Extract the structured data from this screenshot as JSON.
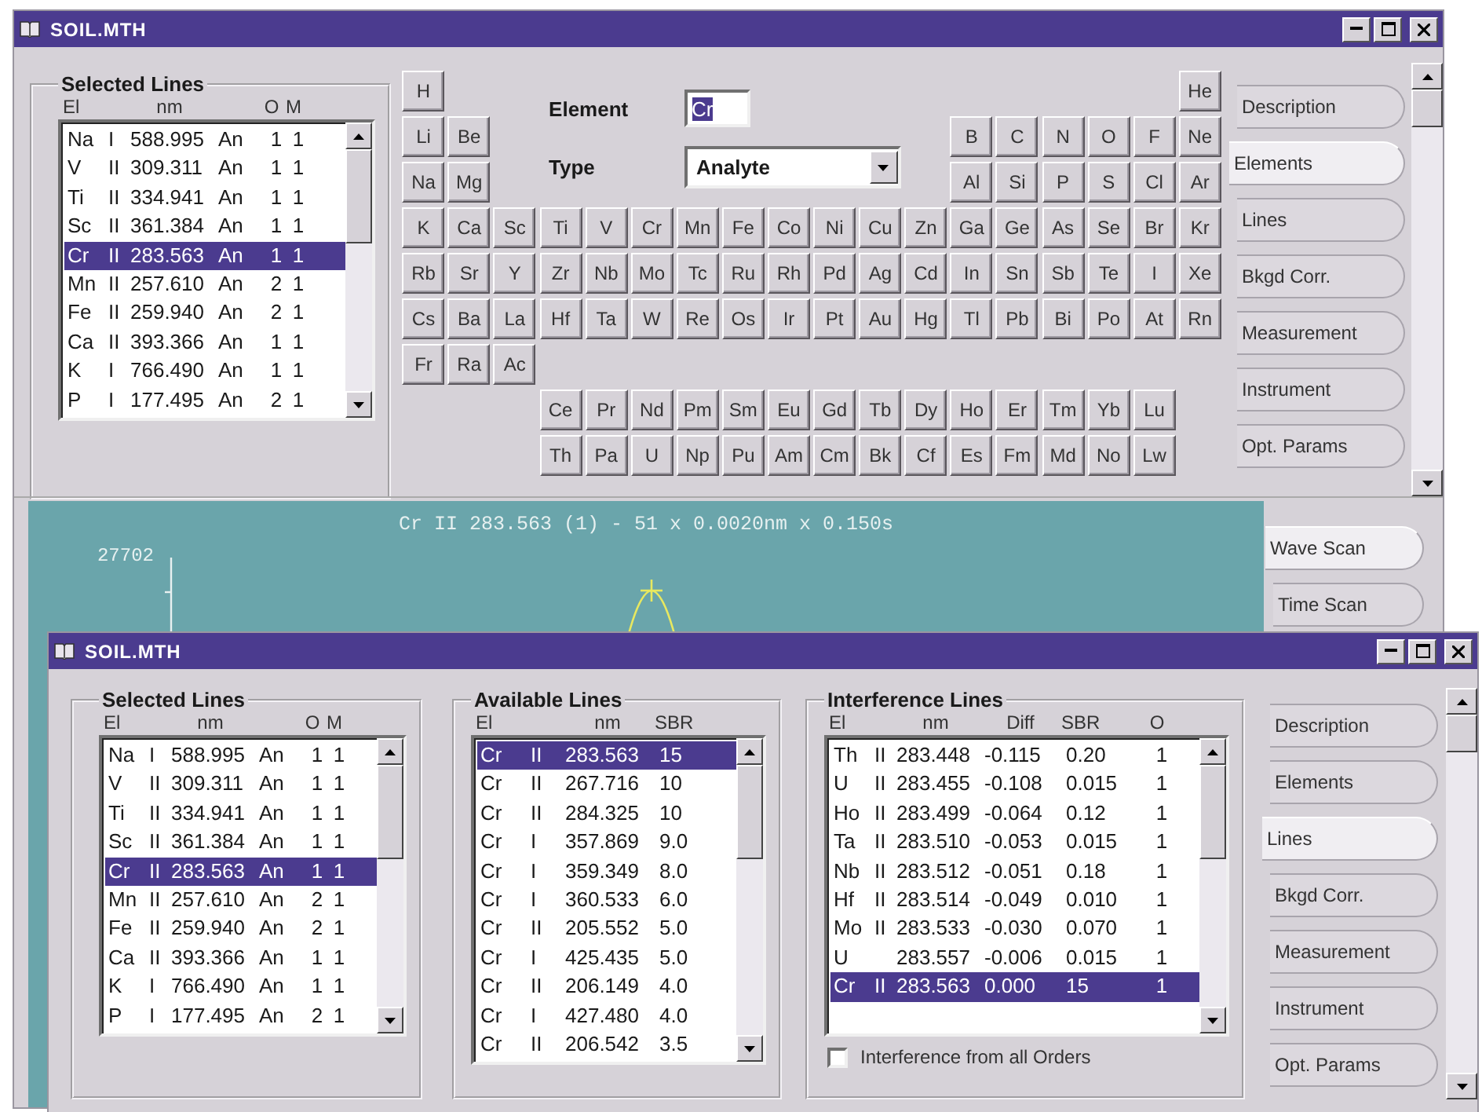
{
  "main_window": {
    "title": "SOIL.MTH",
    "selected_lines": {
      "title": "Selected Lines",
      "kind": "selected",
      "headers": {
        "el": "El",
        "nm": "nm",
        "o": "O",
        "m": "M"
      },
      "rows": [
        {
          "el": "Na",
          "ion": "I",
          "nm": "588.995",
          "type": "An",
          "o": "1",
          "m": "1",
          "selected": false
        },
        {
          "el": "V",
          "ion": "II",
          "nm": "309.311",
          "type": "An",
          "o": "1",
          "m": "1",
          "selected": false
        },
        {
          "el": "Ti",
          "ion": "II",
          "nm": "334.941",
          "type": "An",
          "o": "1",
          "m": "1",
          "selected": false
        },
        {
          "el": "Sc",
          "ion": "II",
          "nm": "361.384",
          "type": "An",
          "o": "1",
          "m": "1",
          "selected": false
        },
        {
          "el": "Cr",
          "ion": "II",
          "nm": "283.563",
          "type": "An",
          "o": "1",
          "m": "1",
          "selected": true
        },
        {
          "el": "Mn",
          "ion": "II",
          "nm": "257.610",
          "type": "An",
          "o": "2",
          "m": "1",
          "selected": false
        },
        {
          "el": "Fe",
          "ion": "II",
          "nm": "259.940",
          "type": "An",
          "o": "2",
          "m": "1",
          "selected": false
        },
        {
          "el": "Ca",
          "ion": "II",
          "nm": "393.366",
          "type": "An",
          "o": "1",
          "m": "1",
          "selected": false
        },
        {
          "el": "K",
          "ion": "I",
          "nm": "766.490",
          "type": "An",
          "o": "1",
          "m": "1",
          "selected": false
        },
        {
          "el": "P",
          "ion": "I",
          "nm": "177.495",
          "type": "An",
          "o": "2",
          "m": "1",
          "selected": false
        }
      ]
    },
    "element_field": {
      "label": "Element",
      "value": "Cr"
    },
    "type_field": {
      "label": "Type",
      "value": "Analyte"
    },
    "periodic_table": [
      [
        "H",
        "He"
      ],
      [
        "Li",
        "Be",
        "B",
        "C",
        "N",
        "O",
        "F",
        "Ne"
      ],
      [
        "Na",
        "Mg",
        "Al",
        "Si",
        "P",
        "S",
        "Cl",
        "Ar"
      ],
      [
        "K",
        "Ca",
        "Sc",
        "Ti",
        "V",
        "Cr",
        "Mn",
        "Fe",
        "Co",
        "Ni",
        "Cu",
        "Zn",
        "Ga",
        "Ge",
        "As",
        "Se",
        "Br",
        "Kr"
      ],
      [
        "Rb",
        "Sr",
        "Y",
        "Zr",
        "Nb",
        "Mo",
        "Tc",
        "Ru",
        "Rh",
        "Pd",
        "Ag",
        "Cd",
        "In",
        "Sn",
        "Sb",
        "Te",
        "I",
        "Xe"
      ],
      [
        "Cs",
        "Ba",
        "La",
        "Hf",
        "Ta",
        "W",
        "Re",
        "Os",
        "Ir",
        "Pt",
        "Au",
        "Hg",
        "Tl",
        "Pb",
        "Bi",
        "Po",
        "At",
        "Rn"
      ],
      [
        "Fr",
        "Ra",
        "Ac"
      ],
      [
        "Ce",
        "Pr",
        "Nd",
        "Pm",
        "Sm",
        "Eu",
        "Gd",
        "Tb",
        "Dy",
        "Ho",
        "Er",
        "Tm",
        "Yb",
        "Lu"
      ],
      [
        "Th",
        "Pa",
        "U",
        "Np",
        "Pu",
        "Am",
        "Cm",
        "Bk",
        "Cf",
        "Es",
        "Fm",
        "Md",
        "No",
        "Lw"
      ]
    ],
    "tabs": [
      {
        "label": "Description",
        "selected": false
      },
      {
        "label": "Elements",
        "selected": true
      },
      {
        "label": "Lines",
        "selected": false
      },
      {
        "label": "Bkgd Corr.",
        "selected": false
      },
      {
        "label": "Measurement",
        "selected": false
      },
      {
        "label": "Instrument",
        "selected": false
      },
      {
        "label": "Opt. Params",
        "selected": false
      }
    ],
    "chart_title": "Cr II 283.563 (1) - 51 x 0.0020nm x 0.150s",
    "y_axis_max": "27702",
    "scan_tabs": [
      {
        "label": "Wave Scan",
        "selected": true
      },
      {
        "label": "Time Scan",
        "selected": false
      }
    ]
  },
  "lines_window": {
    "title": "SOIL.MTH",
    "selected_lines": {
      "title": "Selected Lines",
      "kind": "selected",
      "headers": {
        "el": "El",
        "nm": "nm",
        "o": "O",
        "m": "M"
      },
      "rows": [
        {
          "el": "Na",
          "ion": "I",
          "nm": "588.995",
          "type": "An",
          "o": "1",
          "m": "1",
          "selected": false
        },
        {
          "el": "V",
          "ion": "II",
          "nm": "309.311",
          "type": "An",
          "o": "1",
          "m": "1",
          "selected": false
        },
        {
          "el": "Ti",
          "ion": "II",
          "nm": "334.941",
          "type": "An",
          "o": "1",
          "m": "1",
          "selected": false
        },
        {
          "el": "Sc",
          "ion": "II",
          "nm": "361.384",
          "type": "An",
          "o": "1",
          "m": "1",
          "selected": false
        },
        {
          "el": "Cr",
          "ion": "II",
          "nm": "283.563",
          "type": "An",
          "o": "1",
          "m": "1",
          "selected": true
        },
        {
          "el": "Mn",
          "ion": "II",
          "nm": "257.610",
          "type": "An",
          "o": "2",
          "m": "1",
          "selected": false
        },
        {
          "el": "Fe",
          "ion": "II",
          "nm": "259.940",
          "type": "An",
          "o": "2",
          "m": "1",
          "selected": false
        },
        {
          "el": "Ca",
          "ion": "II",
          "nm": "393.366",
          "type": "An",
          "o": "1",
          "m": "1",
          "selected": false
        },
        {
          "el": "K",
          "ion": "I",
          "nm": "766.490",
          "type": "An",
          "o": "1",
          "m": "1",
          "selected": false
        },
        {
          "el": "P",
          "ion": "I",
          "nm": "177.495",
          "type": "An",
          "o": "2",
          "m": "1",
          "selected": false
        }
      ]
    },
    "available_lines": {
      "title": "Available Lines",
      "kind": "available",
      "headers": {
        "el": "El",
        "nm": "nm",
        "sbr": "SBR"
      },
      "rows": [
        {
          "el": "Cr",
          "ion": "II",
          "nm": "283.563",
          "sbr": "15",
          "selected": true
        },
        {
          "el": "Cr",
          "ion": "II",
          "nm": "267.716",
          "sbr": "10",
          "selected": false
        },
        {
          "el": "Cr",
          "ion": "II",
          "nm": "284.325",
          "sbr": "10",
          "selected": false
        },
        {
          "el": "Cr",
          "ion": "I",
          "nm": "357.869",
          "sbr": "9.0",
          "selected": false
        },
        {
          "el": "Cr",
          "ion": "I",
          "nm": "359.349",
          "sbr": "8.0",
          "selected": false
        },
        {
          "el": "Cr",
          "ion": "I",
          "nm": "360.533",
          "sbr": "6.0",
          "selected": false
        },
        {
          "el": "Cr",
          "ion": "II",
          "nm": "205.552",
          "sbr": "5.0",
          "selected": false
        },
        {
          "el": "Cr",
          "ion": "I",
          "nm": "425.435",
          "sbr": "5.0",
          "selected": false
        },
        {
          "el": "Cr",
          "ion": "II",
          "nm": "206.149",
          "sbr": "4.0",
          "selected": false
        },
        {
          "el": "Cr",
          "ion": "I",
          "nm": "427.480",
          "sbr": "4.0",
          "selected": false
        },
        {
          "el": "Cr",
          "ion": "II",
          "nm": "206.542",
          "sbr": "3.5",
          "selected": false
        }
      ]
    },
    "interference_lines": {
      "title": "Interference Lines",
      "kind": "interference",
      "headers": {
        "el": "El",
        "nm": "nm",
        "diff": "Diff",
        "sbr": "SBR",
        "o": "O"
      },
      "rows": [
        {
          "el": "Th",
          "ion": "II",
          "nm": "283.448",
          "diff": "-0.115",
          "sbr": "0.20",
          "o": "1",
          "selected": false
        },
        {
          "el": "U",
          "ion": "II",
          "nm": "283.455",
          "diff": "-0.108",
          "sbr": "0.015",
          "o": "1",
          "selected": false
        },
        {
          "el": "Ho",
          "ion": "II",
          "nm": "283.499",
          "diff": "-0.064",
          "sbr": "0.12",
          "o": "1",
          "selected": false
        },
        {
          "el": "Ta",
          "ion": "II",
          "nm": "283.510",
          "diff": "-0.053",
          "sbr": "0.015",
          "o": "1",
          "selected": false
        },
        {
          "el": "Nb",
          "ion": "II",
          "nm": "283.512",
          "diff": "-0.051",
          "sbr": "0.18",
          "o": "1",
          "selected": false
        },
        {
          "el": "Hf",
          "ion": "II",
          "nm": "283.514",
          "diff": "-0.049",
          "sbr": "0.010",
          "o": "1",
          "selected": false
        },
        {
          "el": "Mo",
          "ion": "II",
          "nm": "283.533",
          "diff": "-0.030",
          "sbr": "0.070",
          "o": "1",
          "selected": false
        },
        {
          "el": "U",
          "nm": "283.557",
          "diff": "-0.006",
          "sbr": "0.015",
          "o": "1",
          "selected": false
        },
        {
          "el": "Cr",
          "ion": "II",
          "nm": "283.563",
          "diff": "0.000",
          "sbr": "15",
          "o": "1",
          "selected": true
        }
      ],
      "checkbox": {
        "label": "Interference from all Orders",
        "checked": false
      }
    },
    "tabs": [
      {
        "label": "Description",
        "selected": false
      },
      {
        "label": "Elements",
        "selected": false
      },
      {
        "label": "Lines",
        "selected": true
      },
      {
        "label": "Bkgd Corr.",
        "selected": false
      },
      {
        "label": "Measurement",
        "selected": false
      },
      {
        "label": "Instrument",
        "selected": false
      },
      {
        "label": "Opt. Params",
        "selected": false
      }
    ]
  }
}
